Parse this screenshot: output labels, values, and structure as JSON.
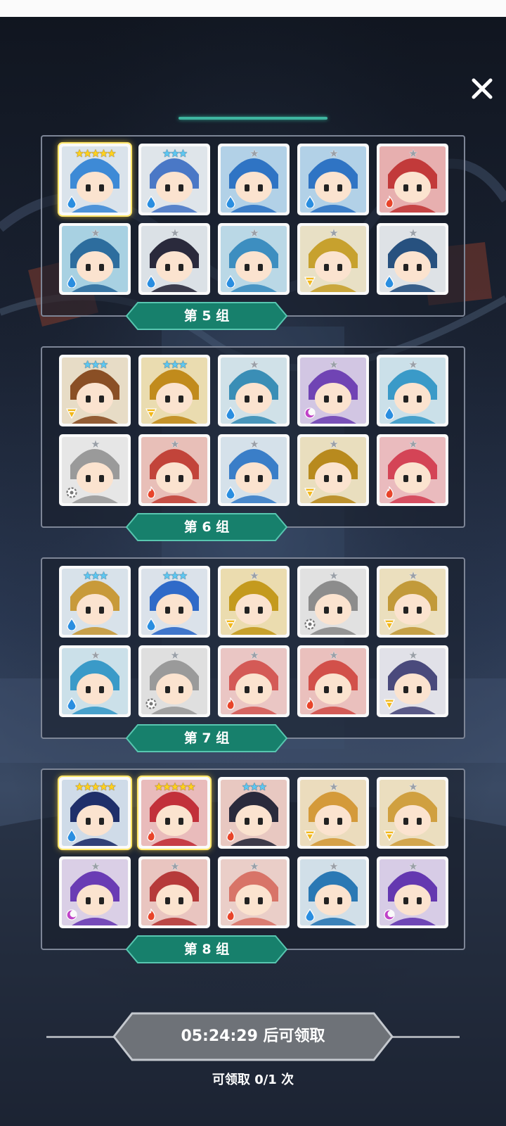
{
  "close_icon": "close-icon",
  "groups": [
    {
      "label": "第 5 组",
      "cards": [
        {
          "name": "clock-mech",
          "tier": "gold",
          "stars": 5,
          "element": "water",
          "colors": [
            "#d8eaf8",
            "#3e8ad6"
          ]
        },
        {
          "name": "horned-yeti",
          "tier": "blue",
          "stars": 3,
          "element": "water",
          "colors": [
            "#e2ecf6",
            "#4a78c6"
          ]
        },
        {
          "name": "crowned-beast-a",
          "tier": "gray",
          "stars": 1,
          "element": "water",
          "colors": [
            "#8fc9f0",
            "#2f74c4"
          ]
        },
        {
          "name": "crowned-beast-b",
          "tier": "gray",
          "stars": 1,
          "element": "water",
          "colors": [
            "#8fc9f0",
            "#2f74c4"
          ]
        },
        {
          "name": "red-chomper",
          "tier": "gray",
          "stars": 1,
          "element": "fire",
          "colors": [
            "#f18a8a",
            "#c23a3a"
          ]
        },
        {
          "name": "blue-skull",
          "tier": "gray",
          "stars": 1,
          "element": "water",
          "colors": [
            "#7ec8e8",
            "#2d6d9e"
          ]
        },
        {
          "name": "dark-hair-girl",
          "tier": "gray",
          "stars": 1,
          "element": "water",
          "colors": [
            "#dbe6ee",
            "#2a2a3c"
          ]
        },
        {
          "name": "blue-golem",
          "tier": "gray",
          "stars": 1,
          "element": "water",
          "colors": [
            "#9ed6ef",
            "#3d8ec0"
          ]
        },
        {
          "name": "winged-knight",
          "tier": "gray",
          "stars": 1,
          "element": "light",
          "colors": [
            "#f3e4b2",
            "#c7a12e"
          ]
        },
        {
          "name": "blue-cap-mage",
          "tier": "gray",
          "stars": 1,
          "element": "water",
          "colors": [
            "#e0e7ef",
            "#27517f"
          ]
        }
      ]
    },
    {
      "label": "第 6 组",
      "cards": [
        {
          "name": "antler-shield",
          "tier": "blue",
          "stars": 3,
          "element": "light",
          "colors": [
            "#f1dcb4",
            "#8a4f25"
          ]
        },
        {
          "name": "golden-clock",
          "tier": "blue",
          "stars": 3,
          "element": "light",
          "colors": [
            "#f5dc8c",
            "#c18b1c"
          ]
        },
        {
          "name": "bandaged-mummy",
          "tier": "gray",
          "stars": 1,
          "element": "water",
          "colors": [
            "#c7e6f2",
            "#3a8eb6"
          ]
        },
        {
          "name": "purple-chomper",
          "tier": "gray",
          "stars": 1,
          "element": "dark",
          "colors": [
            "#cab4ea",
            "#7044b4"
          ]
        },
        {
          "name": "cyan-cat-girl",
          "tier": "gray",
          "stars": 1,
          "element": "water",
          "colors": [
            "#bde4f4",
            "#3a9ac8"
          ]
        },
        {
          "name": "silver-hair-girl",
          "tier": "gray",
          "stars": 1,
          "element": "gear",
          "colors": [
            "#eeeeee",
            "#9a9a9a"
          ]
        },
        {
          "name": "red-block-hero",
          "tier": "gray",
          "stars": 1,
          "element": "fire",
          "colors": [
            "#f3a89a",
            "#c2443a"
          ]
        },
        {
          "name": "blue-winged-knight",
          "tier": "gray",
          "stars": 1,
          "element": "water",
          "colors": [
            "#cfe6f6",
            "#3a7ec8"
          ]
        },
        {
          "name": "golden-emperor",
          "tier": "gray",
          "stars": 1,
          "element": "light",
          "colors": [
            "#f4e0a6",
            "#b88a1e"
          ]
        },
        {
          "name": "red-octopus",
          "tier": "gray",
          "stars": 1,
          "element": "fire",
          "colors": [
            "#f6a0a6",
            "#d44456"
          ]
        }
      ]
    },
    {
      "label": "第 7 组",
      "cards": [
        {
          "name": "crowned-prince",
          "tier": "blue",
          "stars": 3,
          "element": "water",
          "colors": [
            "#d6e8f6",
            "#c89a3a"
          ]
        },
        {
          "name": "royal-king",
          "tier": "blue",
          "stars": 3,
          "element": "water",
          "colors": [
            "#dbe8f6",
            "#2f6ac8"
          ]
        },
        {
          "name": "yellow-chomper",
          "tier": "gray",
          "stars": 1,
          "element": "light",
          "colors": [
            "#f7dc8a",
            "#c49a1e"
          ]
        },
        {
          "name": "gray-chomper",
          "tier": "gray",
          "stars": 1,
          "element": "gear",
          "colors": [
            "#e6e6e6",
            "#8c8c8c"
          ]
        },
        {
          "name": "blonde-warrior",
          "tier": "gray",
          "stars": 1,
          "element": "light",
          "colors": [
            "#f7e2a6",
            "#c29a3a"
          ]
        },
        {
          "name": "cyan-cat-girl-b",
          "tier": "gray",
          "stars": 1,
          "element": "water",
          "colors": [
            "#bde4f4",
            "#3a9ac8"
          ]
        },
        {
          "name": "shell-hood",
          "tier": "gray",
          "stars": 1,
          "element": "gear",
          "colors": [
            "#e2e2e2",
            "#9a9a9a"
          ]
        },
        {
          "name": "pink-horned-girl",
          "tier": "gray",
          "stars": 1,
          "element": "fire",
          "colors": [
            "#f6b4b0",
            "#d45a56"
          ]
        },
        {
          "name": "red-hair-girl",
          "tier": "gray",
          "stars": 1,
          "element": "fire",
          "colors": [
            "#f6aaa4",
            "#d2504a"
          ]
        },
        {
          "name": "lancer-mask",
          "tier": "gray",
          "stars": 1,
          "element": "light",
          "colors": [
            "#e6e6f2",
            "#4a4a7c"
          ]
        }
      ]
    },
    {
      "label": "第 8 组",
      "cards": [
        {
          "name": "ninja-dark",
          "tier": "gold",
          "stars": 5,
          "element": "water",
          "colors": [
            "#c4daf2",
            "#1f2f6a"
          ]
        },
        {
          "name": "red-dragon",
          "tier": "gold",
          "stars": 5,
          "element": "fire",
          "colors": [
            "#f4a0a0",
            "#c2303a"
          ]
        },
        {
          "name": "headset-guy",
          "tier": "blue",
          "stars": 3,
          "element": "fire",
          "colors": [
            "#f3b8ac",
            "#2a2a3c"
          ]
        },
        {
          "name": "shiba-dog",
          "tier": "gray",
          "stars": 1,
          "element": "light",
          "colors": [
            "#f7dca4",
            "#d49a3a"
          ]
        },
        {
          "name": "fox-girl",
          "tier": "gray",
          "stars": 1,
          "element": "light",
          "colors": [
            "#f7e0a8",
            "#d0a040"
          ]
        },
        {
          "name": "purple-visor",
          "tier": "gray",
          "stars": 1,
          "element": "dark",
          "colors": [
            "#d8c4ee",
            "#6a3cb4"
          ]
        },
        {
          "name": "red-helmet",
          "tier": "gray",
          "stars": 1,
          "element": "fire",
          "colors": [
            "#f4b2aa",
            "#b63a3a"
          ]
        },
        {
          "name": "flower-girl",
          "tier": "gray",
          "stars": 1,
          "element": "fire",
          "colors": [
            "#f6c2b8",
            "#d87468"
          ]
        },
        {
          "name": "blue-totem",
          "tier": "gray",
          "stars": 1,
          "element": "water",
          "colors": [
            "#c8e2f2",
            "#2a78b4"
          ]
        },
        {
          "name": "purple-octopus",
          "tier": "gray",
          "stars": 1,
          "element": "dark",
          "colors": [
            "#d4c0ee",
            "#6438b0"
          ]
        }
      ]
    }
  ],
  "footer": {
    "timer_text": "05:24:29 后可领取",
    "claim_text": "可领取 0/1 次"
  },
  "colors": {
    "ribbon": "#17806c",
    "ribbon_edge": "#58c6b0",
    "timer_fill": "#6e7278",
    "timer_edge": "#c4c8ce"
  }
}
